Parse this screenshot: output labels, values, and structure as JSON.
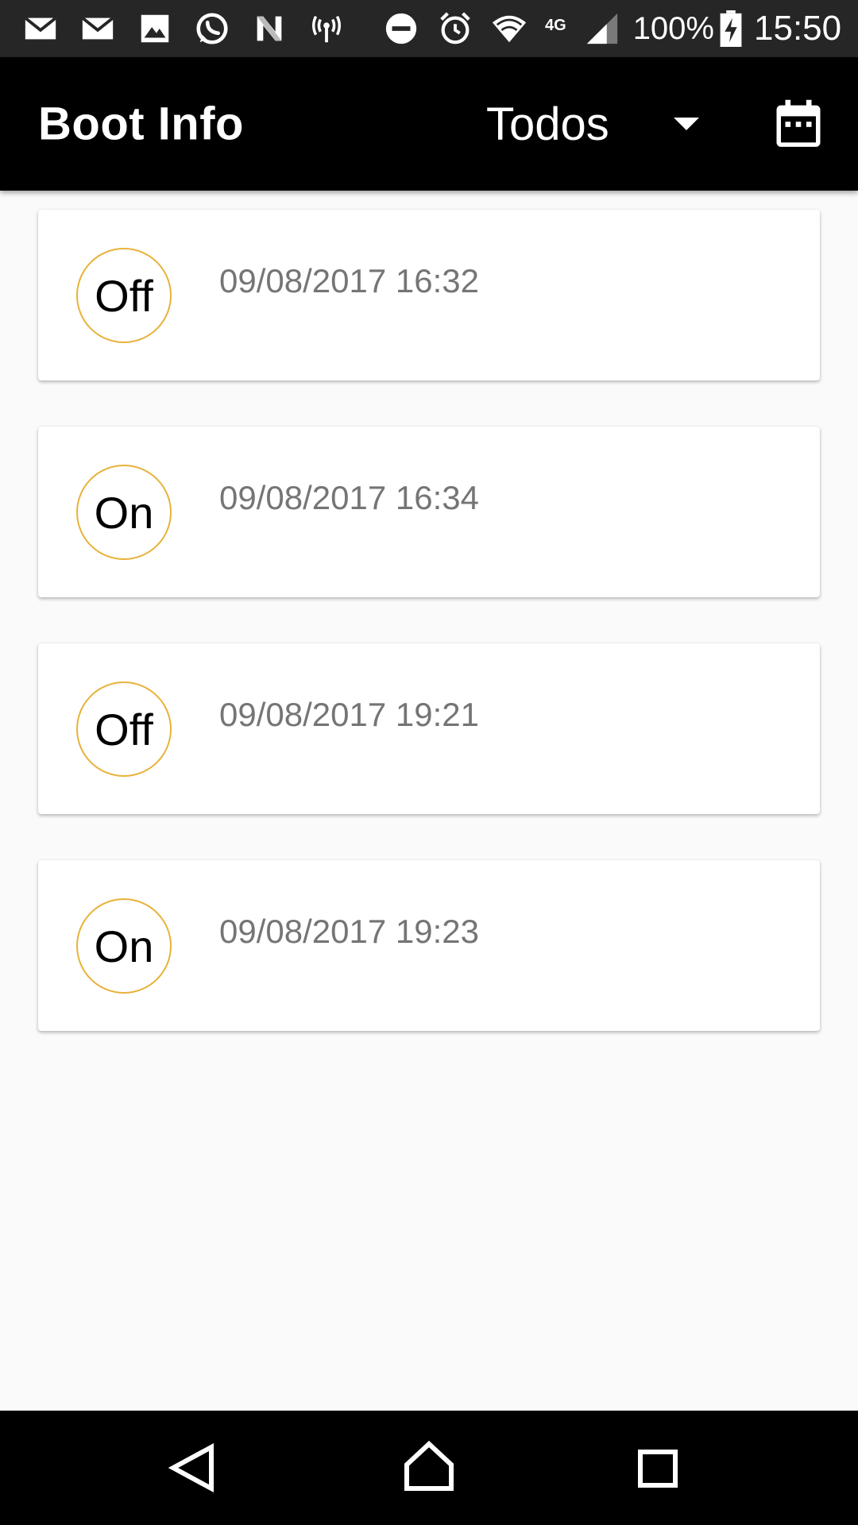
{
  "status_bar": {
    "left_icons": [
      "gmail-icon",
      "gmail-icon",
      "gallery-icon",
      "whatsapp-icon",
      "n-app-icon",
      "hotspot-icon"
    ],
    "right_icons": [
      "do-not-disturb-icon",
      "alarm-icon",
      "wifi-icon",
      "network-4g-icon",
      "signal-icon"
    ],
    "network_label": "4G",
    "battery_percent": "100%",
    "time": "15:50"
  },
  "app_bar": {
    "title": "Boot Info",
    "filter": {
      "selected": "Todos"
    },
    "calendar_icon": "calendar-icon"
  },
  "boot_events": [
    {
      "state": "Off",
      "datetime": "09/08/2017 16:32"
    },
    {
      "state": "On",
      "datetime": "09/08/2017 16:34"
    },
    {
      "state": "Off",
      "datetime": "09/08/2017 19:21"
    },
    {
      "state": "On",
      "datetime": "09/08/2017 19:23"
    }
  ],
  "nav_bar": {
    "icons": [
      "back-icon",
      "home-icon",
      "recents-icon"
    ]
  },
  "colors": {
    "app_bar": "#000000",
    "status_bar": "#262626",
    "accent": "#e8b23a",
    "background": "#fafafa",
    "secondary_text": "#757575"
  }
}
